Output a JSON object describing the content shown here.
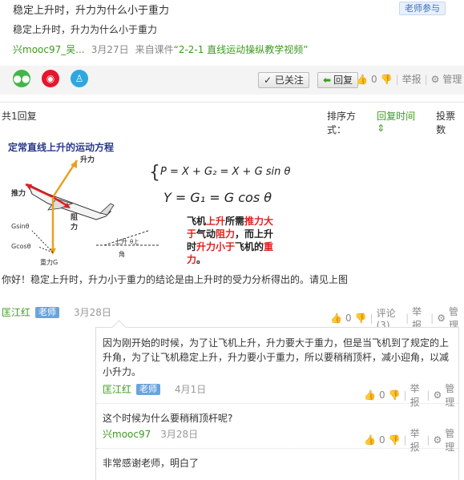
{
  "question": {
    "title": "稳定上升时，升力为什么小于重力",
    "role_tag": "老师参与",
    "body": "稳定上升时，升力为什么小于重力",
    "author": "兴mooc97_吴...",
    "date": "3月27日",
    "source_prefix": "来自课件",
    "source_link": "“2-2-1 直线运动操纵教学视频”",
    "followed_label": "✓ 已关注",
    "reply_label": "回复",
    "like_count": "0",
    "report_label": "举报",
    "manage_label": "管理"
  },
  "replies_bar": {
    "count_label": "共1回复",
    "sort_label": "排序方式：",
    "sort_time": "回复时间",
    "sort_votes": "投票数"
  },
  "figure": {
    "title": "定常直线上升的运动方程",
    "eq1": "P = X + G₂ = X + G sin θ",
    "eq2": "Y = G₁ = G cos θ",
    "label_lift": "升力",
    "label_thrust": "推力",
    "label_drag_1": "阻",
    "label_drag_2": "力",
    "label_g2": "Gsinθ",
    "label_g1": "Gcosθ",
    "label_gravity": "重力G",
    "label_climb": "上升",
    "label_angle": "角",
    "label_theta": "θ上",
    "label_theta2": "θ",
    "note_l1a": "飞机",
    "note_l1b": "上升",
    "note_l1c": "所需",
    "note_l1d": "推力大",
    "note_l2a": "于",
    "note_l2b": "气动",
    "note_l2c": "阻力",
    "note_l2d": "，而上升",
    "note_l3a": "时",
    "note_l3b": "升力小于",
    "note_l3c": "飞机的",
    "note_l3d": "重",
    "note_l4a": "力",
    "note_l4b": "。"
  },
  "answer": {
    "text": "你好！稳定上升时，升力小于重力的结论是由上升时的受力分析得出的。请见上图",
    "author": "匡江红",
    "tag": "老师",
    "date": "3月28日",
    "like_count": "0",
    "comment_label": "评论(3)",
    "report_label": "举报",
    "manage_label": "管理"
  },
  "comments": [
    {
      "text": "因为刚开始的时候，为了让飞机上升，升力要大于重力，但是当飞机到了规定的上升角，为了让飞机稳定上升，升力要小于重力，所以要稍稍顶杆，减小迎角，以减小升力。",
      "author": "匡江红",
      "tag": "老师",
      "date": "4月1日",
      "like_count": "0",
      "report_label": "举报",
      "manage_label": "管理"
    },
    {
      "text": "这个时候为什么要稍稍顶杆呢?",
      "author": "兴mooc97",
      "date": "3月28日",
      "like_count": "0",
      "report_label": "举报",
      "manage_label": "管理"
    },
    {
      "text": "非常感谢老师，明白了"
    }
  ],
  "colors": {
    "accent_green": "#3c9a1f",
    "teacher_blue": "#6aa4dc",
    "figure_red": "#e02020",
    "figure_orange": "#e8a020"
  }
}
